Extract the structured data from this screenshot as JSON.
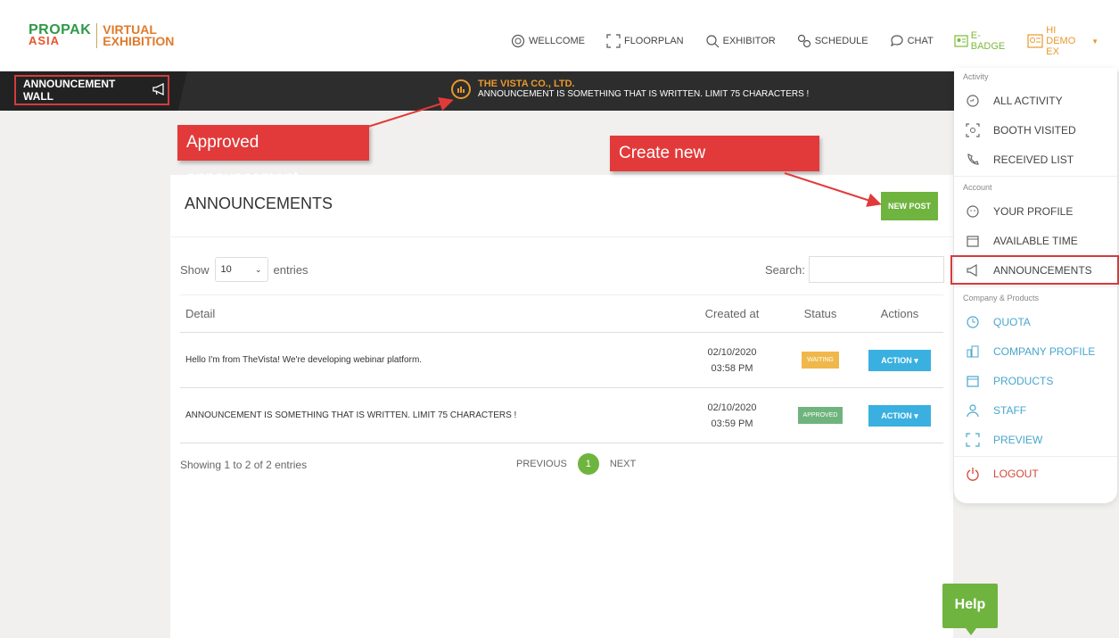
{
  "logo": {
    "brand_top": "PROPAK",
    "brand_bottom": "ASIA",
    "sub_top": "VIRTUAL",
    "sub_bottom": "EXHIBITION"
  },
  "nav": {
    "items": [
      {
        "label": "WELLCOME",
        "icon": "globe-icon"
      },
      {
        "label": "FLOORPLAN",
        "icon": "floorplan-icon"
      },
      {
        "label": "EXHIBITOR",
        "icon": "search-icon"
      },
      {
        "label": "SCHEDULE",
        "icon": "schedule-icon"
      },
      {
        "label": "CHAT",
        "icon": "chat-icon"
      },
      {
        "label": "E-BADGE",
        "icon": "badge-icon"
      },
      {
        "label": "HI DEMO EX",
        "icon": "user-icon"
      }
    ]
  },
  "announcement_bar": {
    "wall_label": "ANNOUNCEMENT WALL",
    "company": "THE VISTA CO., LTD.",
    "message": "ANNOUNCEMENT IS SOMETHING THAT IS WRITTEN. LIMIT 75 CHARACTERS !"
  },
  "callouts": {
    "approved": "Approved announcement",
    "create": "Create new announcement"
  },
  "card": {
    "title": "ANNOUNCEMENTS",
    "new_post": "NEW POST",
    "show_label": "Show",
    "entries_value": "10",
    "entries_label": "entries",
    "search_label": "Search:",
    "columns": {
      "detail": "Detail",
      "created": "Created at",
      "status": "Status",
      "actions": "Actions"
    },
    "rows": [
      {
        "detail": "Hello I'm from TheVista! We're developing webinar platform.",
        "date": "02/10/2020",
        "time": "03:58 PM",
        "status": "WAITING",
        "action": "ACTION"
      },
      {
        "detail": "ANNOUNCEMENT IS SOMETHING THAT IS WRITTEN. LIMIT 75 CHARACTERS !",
        "date": "02/10/2020",
        "time": "03:59 PM",
        "status": "APPROVED",
        "action": "ACTION"
      }
    ],
    "showing": "Showing 1 to 2 of 2 entries",
    "previous": "PREVIOUS",
    "page": "1",
    "next": "NEXT"
  },
  "menu": {
    "sections": {
      "activity": "Activity",
      "account": "Account",
      "company": "Company & Products"
    },
    "activity": [
      {
        "label": "ALL ACTIVITY",
        "icon": "activity-icon"
      },
      {
        "label": "BOOTH VISITED",
        "icon": "booth-icon"
      },
      {
        "label": "RECEIVED LIST",
        "icon": "received-icon"
      }
    ],
    "account": [
      {
        "label": "YOUR PROFILE",
        "icon": "profile-icon"
      },
      {
        "label": "AVAILABLE TIME",
        "icon": "calendar-icon"
      },
      {
        "label": "ANNOUNCEMENTS",
        "icon": "megaphone-icon"
      }
    ],
    "company": [
      {
        "label": "QUOTA",
        "icon": "quota-icon"
      },
      {
        "label": "COMPANY PROFILE",
        "icon": "company-icon"
      },
      {
        "label": "PRODUCTS",
        "icon": "products-icon"
      },
      {
        "label": "STAFF",
        "icon": "staff-icon"
      },
      {
        "label": "PREVIEW",
        "icon": "preview-icon"
      }
    ],
    "logout": "LOGOUT"
  },
  "help": "Help",
  "colors": {
    "green": "#6fb43f",
    "orange": "#e8982d",
    "blue": "#3ab0e0",
    "red": "#e23a3a",
    "dark": "#2d2d2d"
  }
}
